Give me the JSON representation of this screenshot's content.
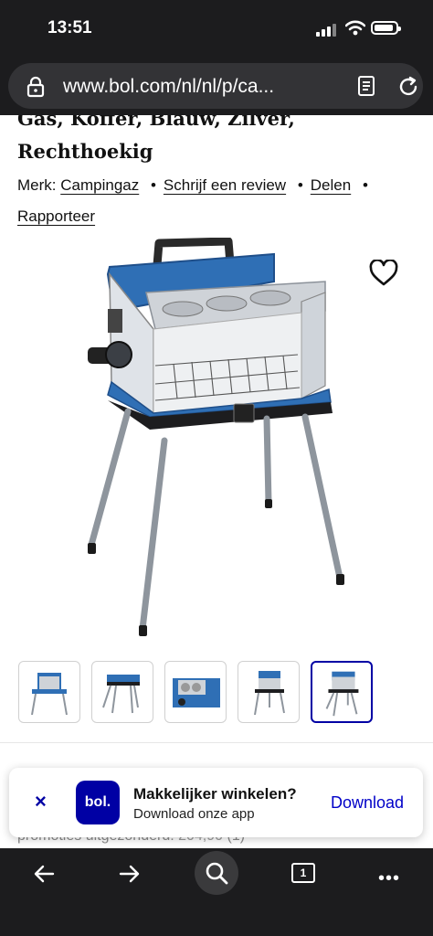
{
  "status": {
    "time": "13:51"
  },
  "browser": {
    "url": "www.bol.com/nl/nl/p/ca..."
  },
  "product": {
    "title_cut": "Gas, Koffer, Blauw, Zilver,",
    "title_line": "Rechthoekig",
    "merk_label": "Merk:",
    "merk_value": "Campingaz",
    "links": {
      "review": "Schrijf een review",
      "share": "Delen",
      "report": "Rapporteer"
    },
    "separator": "•",
    "thumbnail_count": 5,
    "active_thumbnail": 5
  },
  "below_banner": {
    "text": "promoties uitgezonderd:",
    "old_price": "204,90",
    "count": "(1)"
  },
  "app_banner": {
    "close": "×",
    "logo": "bol.",
    "title": "Makkelijker winkelen?",
    "subtitle": "Download onze app",
    "download": "Download"
  },
  "toolbar": {
    "tabs_count": "1",
    "more": "•••"
  },
  "colors": {
    "brand_blue": "#0000a4",
    "grill_blue": "#2f6fb5"
  }
}
